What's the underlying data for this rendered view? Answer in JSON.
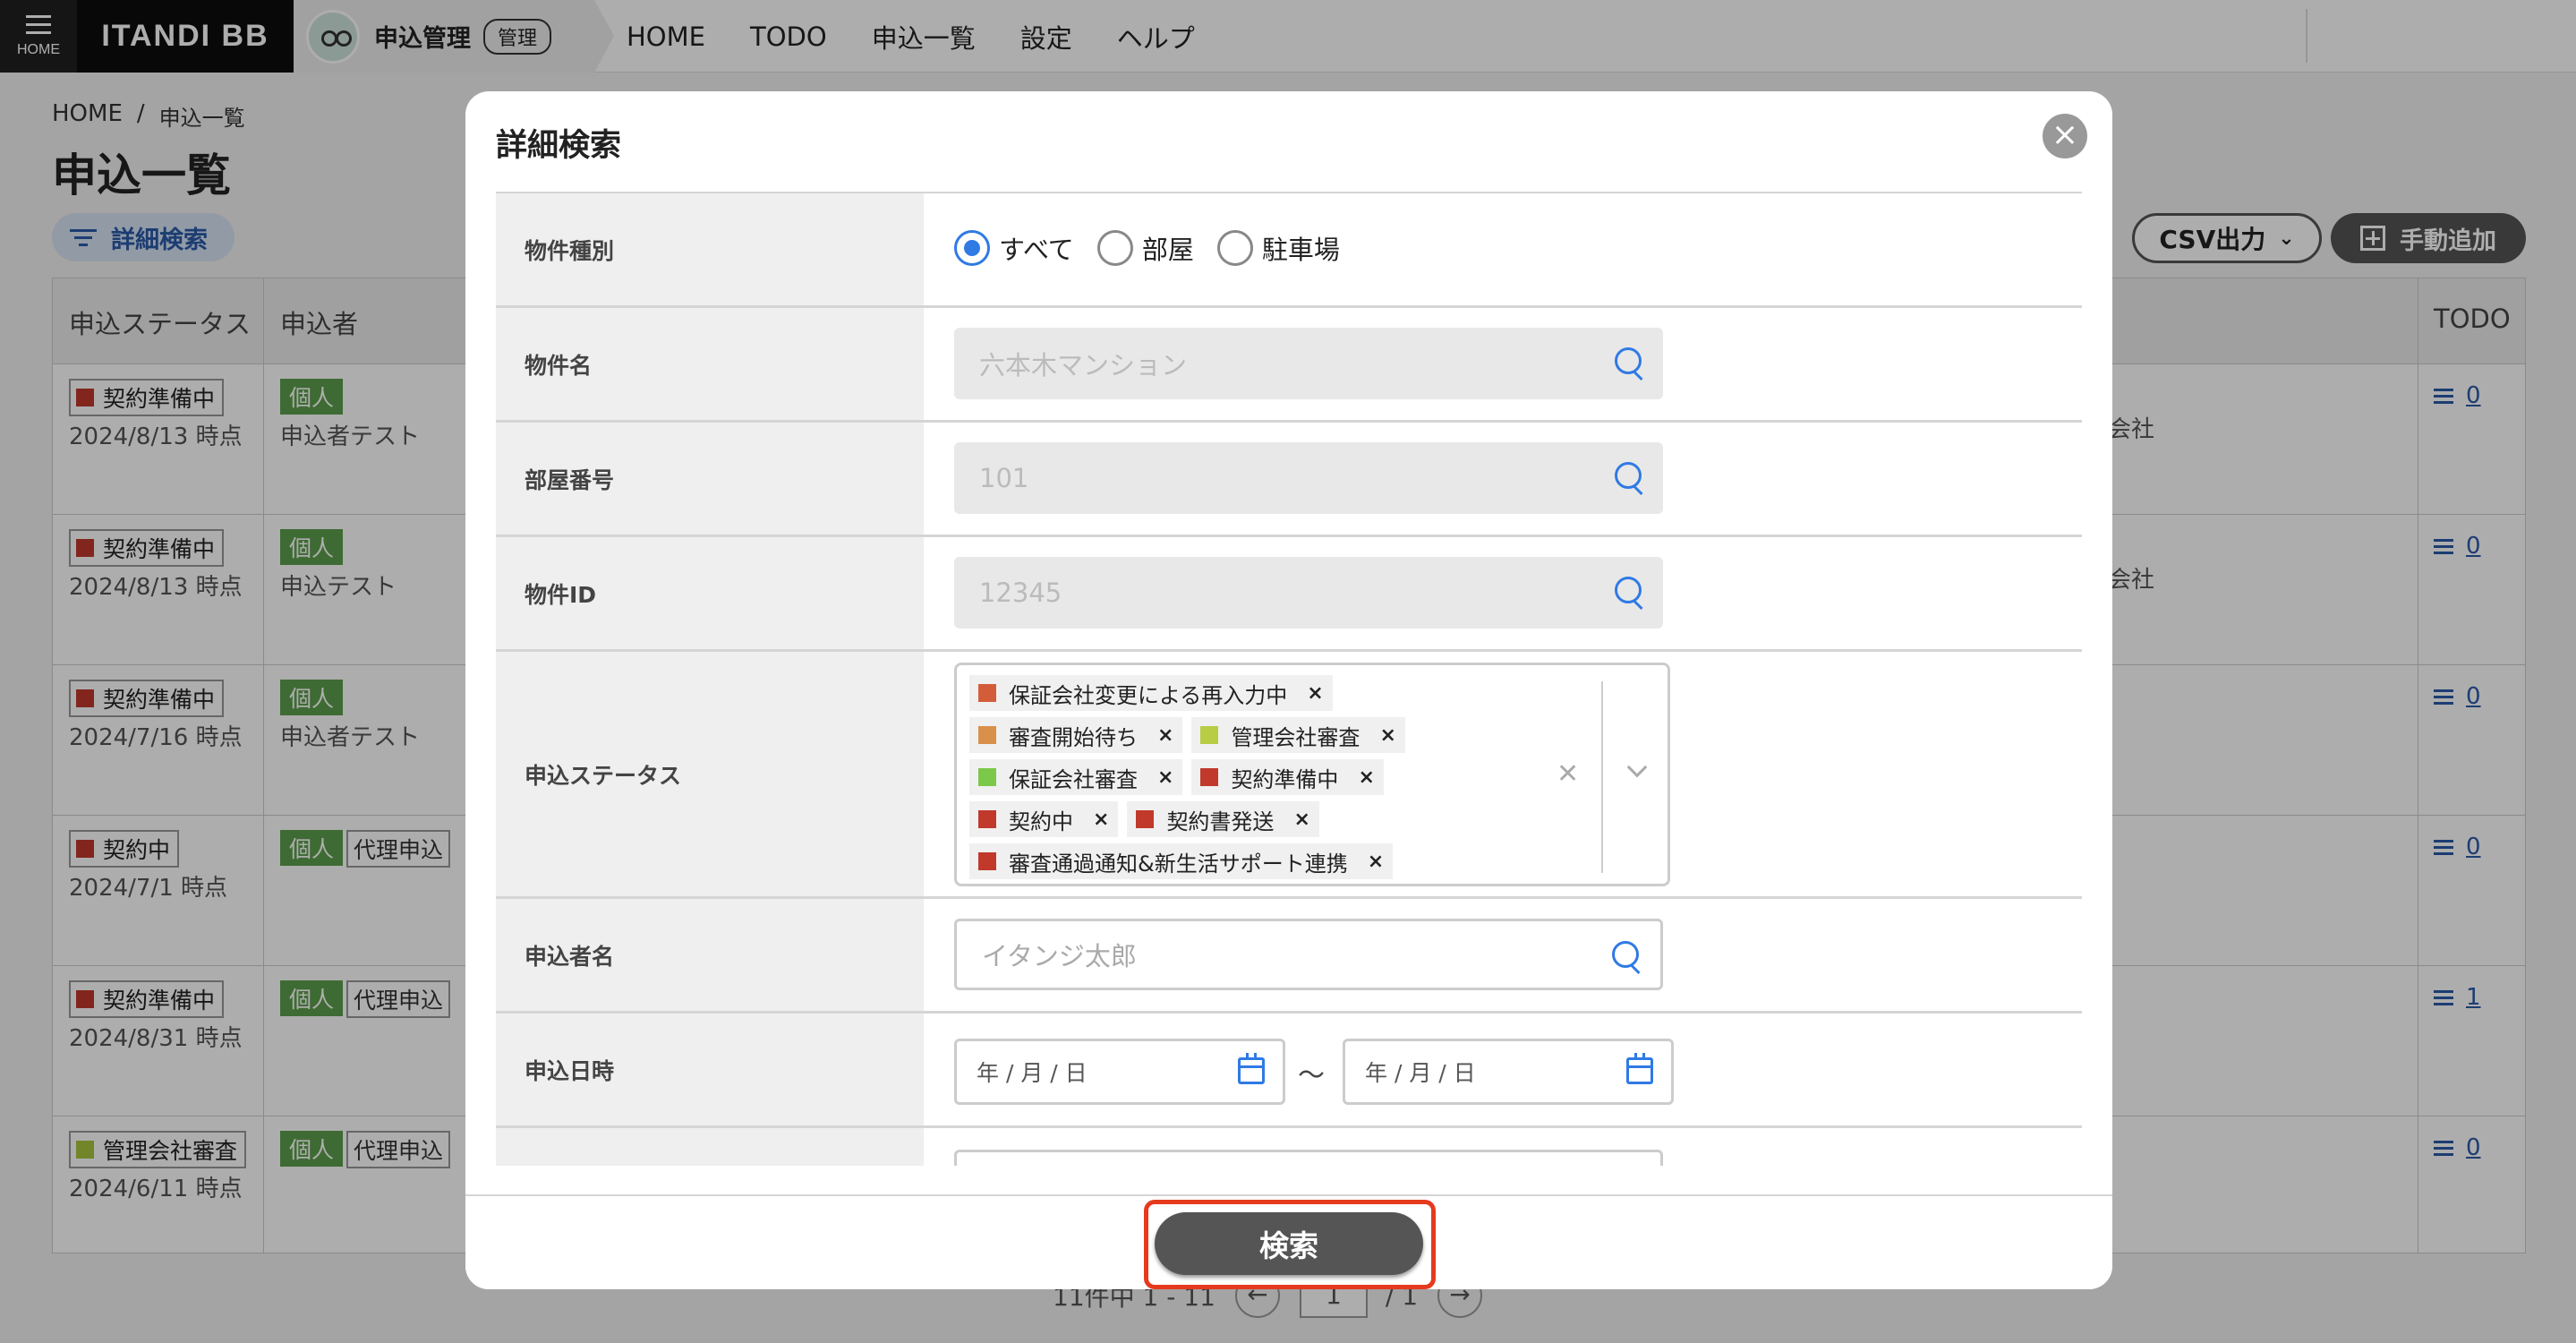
{
  "nav": {
    "home_label": "HOME",
    "logo": "ITANDI BB",
    "app_name": "申込管理",
    "app_tag": "管理",
    "items": [
      "HOME",
      "TODO",
      "申込一覧",
      "設定",
      "ヘルプ"
    ]
  },
  "page": {
    "breadcrumb_home": "HOME",
    "breadcrumb_sep": "/",
    "breadcrumb_current": "申込一覧",
    "title": "申込一覧",
    "filter_label": "詳細検索",
    "csv_label": "CSV出力",
    "add_label": "手動追加"
  },
  "table": {
    "headers": [
      "申込ステータス",
      "申込者",
      "TODO"
    ],
    "rows": [
      {
        "status": "契約準備中",
        "status_color": "#c0392b",
        "date": "2024/8/13 時点",
        "tag": "個人",
        "agent": "",
        "applicant": "申込者テスト",
        "company": "会社",
        "todo": "0"
      },
      {
        "status": "契約準備中",
        "status_color": "#c0392b",
        "date": "2024/8/13 時点",
        "tag": "個人",
        "agent": "",
        "applicant": "申込テスト",
        "company": "会社",
        "todo": "0"
      },
      {
        "status": "契約準備中",
        "status_color": "#c0392b",
        "date": "2024/7/16 時点",
        "tag": "個人",
        "agent": "",
        "applicant": "申込者テスト",
        "company": "",
        "todo": "0"
      },
      {
        "status": "契約中",
        "status_color": "#c0392b",
        "date": "2024/7/1 時点",
        "tag": "個人",
        "agent": "代理申込",
        "applicant": "",
        "company": "",
        "todo": "0"
      },
      {
        "status": "契約準備中",
        "status_color": "#c0392b",
        "date": "2024/8/31 時点",
        "tag": "個人",
        "agent": "代理申込",
        "applicant": "",
        "company": "",
        "todo": "1"
      },
      {
        "status": "管理会社審査",
        "status_color": "#a8c43c",
        "date": "2024/6/11 時点",
        "tag": "個人",
        "agent": "代理申込",
        "applicant": "",
        "company": "",
        "todo": "0"
      }
    ],
    "pager_text": "11件中 1 - 11",
    "pager_page": "1",
    "pager_total": "/ 1"
  },
  "modal": {
    "title": "詳細検索",
    "close_icon": "close-icon",
    "fields": {
      "property_type": {
        "label": "物件種別",
        "options": [
          "すべて",
          "部屋",
          "駐車場"
        ],
        "selected": "すべて"
      },
      "property_name": {
        "label": "物件名",
        "placeholder": "六本木マンション"
      },
      "room_number": {
        "label": "部屋番号",
        "placeholder": "101"
      },
      "property_id": {
        "label": "物件ID",
        "placeholder": "12345"
      },
      "status": {
        "label": "申込ステータス",
        "chips": [
          {
            "label": "保証会社変更による再入力中",
            "color": "#d35d3a"
          },
          {
            "label": "審査開始待ち",
            "color": "#d9904a"
          },
          {
            "label": "管理会社審査",
            "color": "#b8cc44"
          },
          {
            "label": "保証会社審査",
            "color": "#7cc84a"
          },
          {
            "label": "契約準備中",
            "color": "#c0392b"
          },
          {
            "label": "契約中",
            "color": "#c0392b"
          },
          {
            "label": "契約書発送",
            "color": "#c0392b"
          },
          {
            "label": "審査通過通知&新生活サポート連携",
            "color": "#c0392b"
          }
        ],
        "remove_glyph": "×",
        "clear_glyph": "✕"
      },
      "applicant_name": {
        "label": "申込者名",
        "placeholder": "イタンジ太郎"
      },
      "applied_date": {
        "label": "申込日時",
        "from_placeholder": "年 / 月 / 日",
        "to_placeholder": "年 / 月 / 日",
        "separator": "〜"
      }
    },
    "search_label": "検索"
  }
}
